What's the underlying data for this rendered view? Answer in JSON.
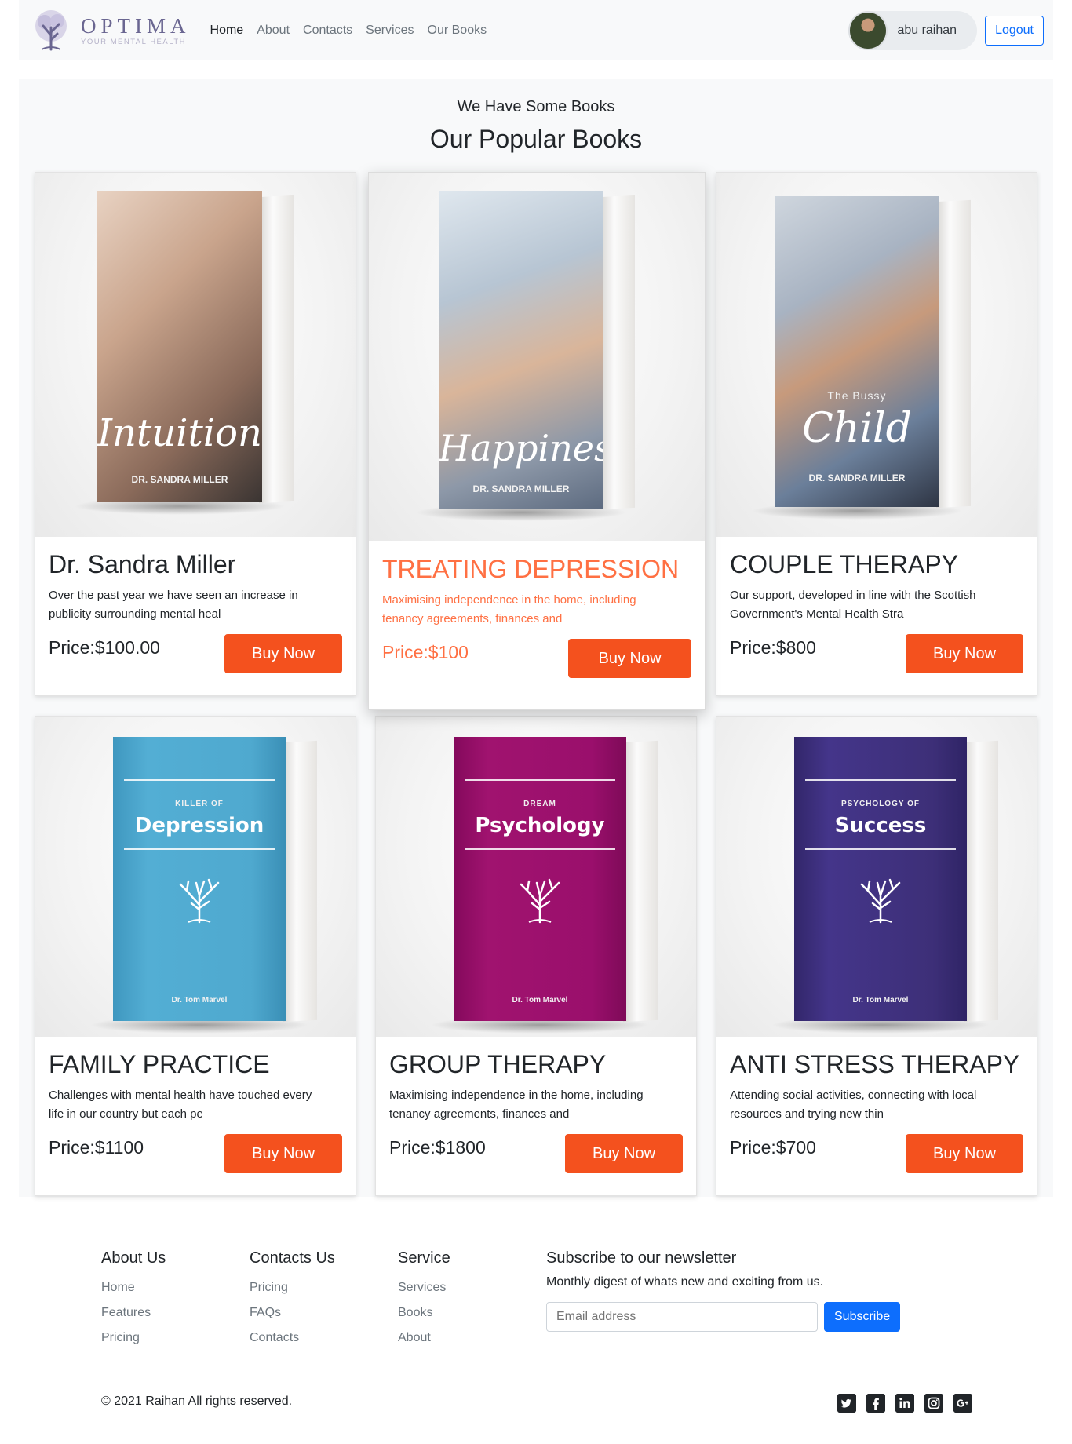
{
  "brand": {
    "name": "OPTIMA",
    "tagline": "YOUR MENTAL HEALTH"
  },
  "nav": {
    "links": [
      "Home",
      "About",
      "Contacts",
      "Services",
      "Our Books"
    ],
    "active": "Home",
    "user_name": "abu raihan",
    "logout_label": "Logout"
  },
  "books_section": {
    "subtitle": "We Have Some Books",
    "title": "Our Popular Books",
    "cards": [
      {
        "title": "Dr. Sandra Miller",
        "text": "Over the past year we have seen an increase in publicity surrounding mental heal",
        "price": "Price:$100.00",
        "button": "Buy Now",
        "cover": {
          "title": "Intuition",
          "author": "DR. SANDRA MILLER",
          "color": "#8a6a5a"
        }
      },
      {
        "title": "TREATING DEPRESSION",
        "text": "Maximising independence in the home, including tenancy agreements, finances and",
        "price": "Price:$100",
        "button": "Buy Now",
        "cover": {
          "title": "Happines",
          "author": "DR. SANDRA MILLER",
          "color": "#9fb0c4"
        }
      },
      {
        "title": "COUPLE THERAPY",
        "text": "Our support, developed in line with the Scottish Government's Mental Health Stra",
        "price": "Price:$800",
        "button": "Buy Now",
        "cover": {
          "kicker": "The Bussy",
          "title": "Child",
          "author": "DR. SANDRA MILLER",
          "color": "#6b7f9a"
        }
      },
      {
        "title": "FAMILY PRACTICE",
        "text": "Challenges with mental health have touched every life in our country but each pe",
        "price": "Price:$1100",
        "button": "Buy Now",
        "cover": {
          "kicker": "KILLER OF",
          "title": "Depression",
          "author": "Dr. Tom Marvel",
          "color": "#4fa9cf"
        }
      },
      {
        "title": "GROUP THERAPY",
        "text": "Maximising independence in the home, including tenancy agreements, finances and",
        "price": "Price:$1800",
        "button": "Buy Now",
        "cover": {
          "kicker": "DREAM",
          "title": "Psychology",
          "author": "Dr. Tom Marvel",
          "color": "#9a0f6c"
        }
      },
      {
        "title": "ANTI STRESS THERAPY",
        "text": "Attending social activities, connecting with local resources and trying new thin",
        "price": "Price:$700",
        "button": "Buy Now",
        "cover": {
          "kicker": "PSYCHOLOGY OF",
          "title": "Success",
          "author": "Dr. Tom Marvel",
          "color": "#3d2f78"
        }
      }
    ]
  },
  "footer": {
    "about": {
      "heading": "About Us",
      "links": [
        "Home",
        "Features",
        "Pricing"
      ]
    },
    "contacts": {
      "heading": "Contacts Us",
      "links": [
        "Pricing",
        "FAQs",
        "Contacts"
      ]
    },
    "service": {
      "heading": "Service",
      "links": [
        "Services",
        "Books",
        "About"
      ]
    },
    "newsletter": {
      "heading": "Subscribe to our newsletter",
      "text": "Monthly digest of whats new and exciting from us.",
      "placeholder": "Email address",
      "button": "Subscribe"
    },
    "copyright": "© 2021 Raihan All rights reserved.",
    "socials": [
      "twitter-icon",
      "facebook-icon",
      "linkedin-icon",
      "instagram-icon",
      "google-plus-icon"
    ]
  },
  "colors": {
    "accent": "#f4511e",
    "featured_text": "#ff7043",
    "primary": "#0d6efd"
  }
}
